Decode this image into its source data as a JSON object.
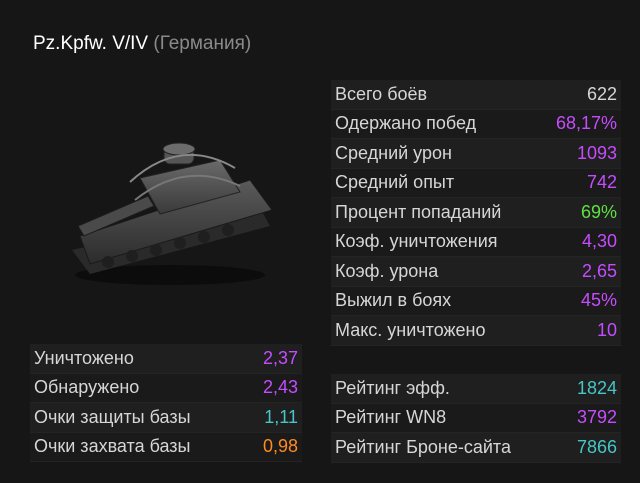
{
  "tank": {
    "name": "Pz.Kpfw. V/IV",
    "nation": "(Германия)"
  },
  "main_stats": [
    {
      "label": "Всего боёв",
      "value": "622",
      "color": "white"
    },
    {
      "label": "Одержано побед",
      "value": "68,17%",
      "color": "purple"
    },
    {
      "label": "Средний урон",
      "value": "1093",
      "color": "purple"
    },
    {
      "label": "Средний опыт",
      "value": "742",
      "color": "purple"
    },
    {
      "label": "Процент попаданий",
      "value": "69%",
      "color": "green"
    },
    {
      "label": "Коэф. уничтожения",
      "value": "4,30",
      "color": "purple"
    },
    {
      "label": "Коэф. урона",
      "value": "2,65",
      "color": "purple"
    },
    {
      "label": "Выжил в боях",
      "value": "45%",
      "color": "purple"
    },
    {
      "label": "Макс. уничтожено",
      "value": "10",
      "color": "purple"
    }
  ],
  "avg_stats": [
    {
      "label": "Уничтожено",
      "value": "2,37",
      "color": "purple"
    },
    {
      "label": "Обнаружено",
      "value": "2,43",
      "color": "purple"
    },
    {
      "label": "Очки защиты базы",
      "value": "1,11",
      "color": "teal"
    },
    {
      "label": "Очки захвата базы",
      "value": "0,98",
      "color": "orange"
    }
  ],
  "ratings": [
    {
      "label": "Рейтинг эфф.",
      "value": "1824",
      "color": "teal"
    },
    {
      "label": "Рейтинг WN8",
      "value": "3792",
      "color": "purple"
    },
    {
      "label": "Рейтинг Броне-сайта",
      "value": "7866",
      "color": "teal"
    }
  ],
  "colors": {
    "purple": "#c64cff",
    "green": "#5fe043",
    "teal": "#46c6c6",
    "orange": "#ff8a1e",
    "white": "#d6d6d6"
  }
}
